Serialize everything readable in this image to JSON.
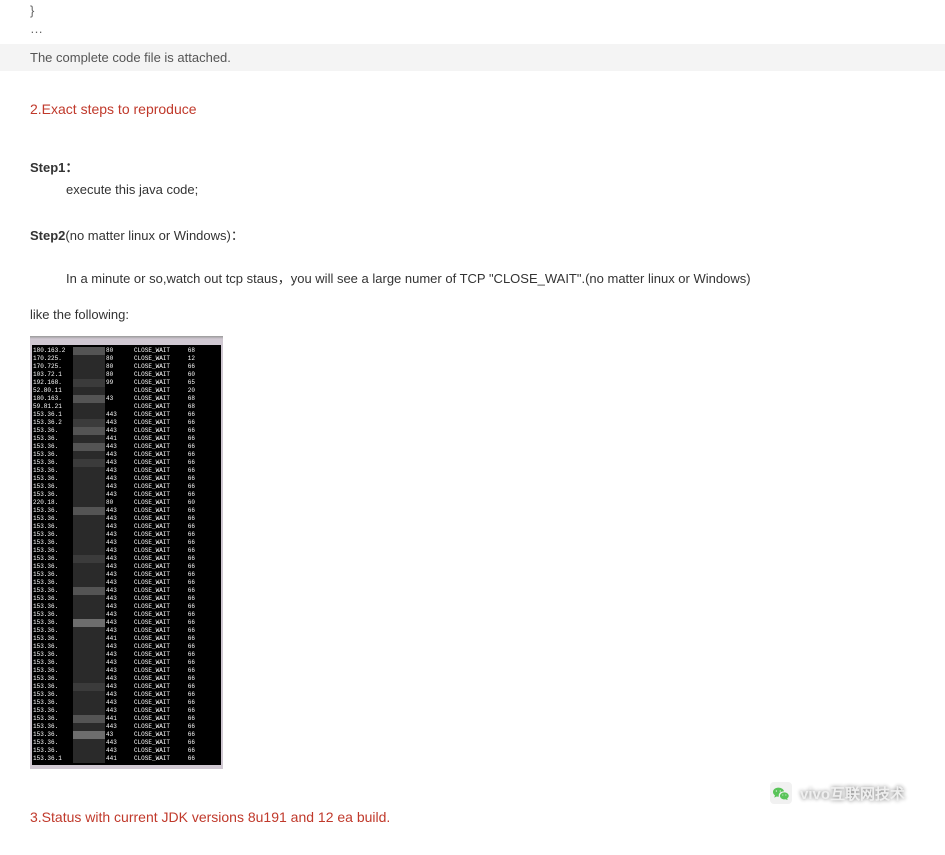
{
  "codeLines": [
    "}",
    "…"
  ],
  "attachedNote": "The complete code file is attached.",
  "section2": "2.Exact steps to reproduce",
  "step1Label": "Step1：",
  "step1Body": "execute this java code;",
  "step2Label": "Step2",
  "step2Rest": "(no matter linux or Windows)：",
  "watchLine": "In a minute or so,watch out tcp staus，you will see a large numer of TCP \"CLOSE_WAIT\".(no matter linux or Windows)",
  "likeLine": "like the following:",
  "section3": "3.Status with current JDK versions 8u191 and 12 ea build.",
  "watermarkText": "vivo互联网技术",
  "terminalRows": [
    {
      "ip": "180.163.2",
      "port": "80",
      "status": "CLOSE_WAIT",
      "count": "68",
      "mask": "c"
    },
    {
      "ip": "170.225.",
      "port": "80",
      "status": "CLOSE_WAIT",
      "count": "12",
      "mask": "a"
    },
    {
      "ip": "170.725.",
      "port": "80",
      "status": "CLOSE_WAIT",
      "count": "66",
      "mask": "a"
    },
    {
      "ip": "103.72.1",
      "port": "80",
      "status": "CLOSE_WAIT",
      "count": "60",
      "mask": "a"
    },
    {
      "ip": "192.168.",
      "port": "99",
      "status": "CLOSE_WAIT",
      "count": "65",
      "mask": "b"
    },
    {
      "ip": "52.80.11",
      "port": "",
      "status": "CLOSE_WAIT",
      "count": "20",
      "mask": "a"
    },
    {
      "ip": "180.163.",
      "port": "43",
      "status": "CLOSE_WAIT",
      "count": "68",
      "mask": "c"
    },
    {
      "ip": "59.81.21",
      "port": "",
      "status": "CLOSE_WAIT",
      "count": "68",
      "mask": "a"
    },
    {
      "ip": "153.36.1",
      "port": "443",
      "status": "CLOSE_WAIT",
      "count": "66",
      "mask": "a"
    },
    {
      "ip": "153.36.2",
      "port": "443",
      "status": "CLOSE_WAIT",
      "count": "66",
      "mask": "b"
    },
    {
      "ip": "153.36.",
      "port": "443",
      "status": "CLOSE_WAIT",
      "count": "66",
      "mask": "c"
    },
    {
      "ip": "153.36.",
      "port": "441",
      "status": "CLOSE_WAIT",
      "count": "66",
      "mask": "a"
    },
    {
      "ip": "153.36.",
      "port": "443",
      "status": "CLOSE_WAIT",
      "count": "66",
      "mask": "c"
    },
    {
      "ip": "153.36.",
      "port": "443",
      "status": "CLOSE_WAIT",
      "count": "66",
      "mask": "a"
    },
    {
      "ip": "153.36.",
      "port": "443",
      "status": "CLOSE_WAIT",
      "count": "66",
      "mask": "b"
    },
    {
      "ip": "153.36.",
      "port": "443",
      "status": "CLOSE_WAIT",
      "count": "66",
      "mask": "a"
    },
    {
      "ip": "153.36.",
      "port": "443",
      "status": "CLOSE_WAIT",
      "count": "66",
      "mask": "a"
    },
    {
      "ip": "153.36.",
      "port": "443",
      "status": "CLOSE_WAIT",
      "count": "66",
      "mask": "a"
    },
    {
      "ip": "153.36.",
      "port": "443",
      "status": "CLOSE_WAIT",
      "count": "66",
      "mask": "a"
    },
    {
      "ip": "220.18.",
      "port": "80",
      "status": "CLOSE_WAIT",
      "count": "60",
      "mask": "a"
    },
    {
      "ip": "153.36.",
      "port": "443",
      "status": "CLOSE_WAIT",
      "count": "66",
      "mask": "c"
    },
    {
      "ip": "153.36.",
      "port": "443",
      "status": "CLOSE_WAIT",
      "count": "66",
      "mask": "a"
    },
    {
      "ip": "153.36.",
      "port": "443",
      "status": "CLOSE_WAIT",
      "count": "66",
      "mask": "a"
    },
    {
      "ip": "153.36.",
      "port": "443",
      "status": "CLOSE_WAIT",
      "count": "66",
      "mask": "a"
    },
    {
      "ip": "153.36.",
      "port": "443",
      "status": "CLOSE_WAIT",
      "count": "66",
      "mask": "a"
    },
    {
      "ip": "153.36.",
      "port": "443",
      "status": "CLOSE_WAIT",
      "count": "66",
      "mask": "a"
    },
    {
      "ip": "153.36.",
      "port": "443",
      "status": "CLOSE_WAIT",
      "count": "66",
      "mask": "b"
    },
    {
      "ip": "153.36.",
      "port": "443",
      "status": "CLOSE_WAIT",
      "count": "66",
      "mask": "a"
    },
    {
      "ip": "153.36.",
      "port": "443",
      "status": "CLOSE_WAIT",
      "count": "66",
      "mask": "a"
    },
    {
      "ip": "153.36.",
      "port": "443",
      "status": "CLOSE_WAIT",
      "count": "66",
      "mask": "a"
    },
    {
      "ip": "153.36.",
      "port": "443",
      "status": "CLOSE_WAIT",
      "count": "66",
      "mask": "c"
    },
    {
      "ip": "153.36.",
      "port": "443",
      "status": "CLOSE_WAIT",
      "count": "66",
      "mask": "a"
    },
    {
      "ip": "153.36.",
      "port": "443",
      "status": "CLOSE_WAIT",
      "count": "66",
      "mask": "a"
    },
    {
      "ip": "153.36.",
      "port": "443",
      "status": "CLOSE_WAIT",
      "count": "66",
      "mask": "a"
    },
    {
      "ip": "153.36.",
      "port": "443",
      "status": "CLOSE_WAIT",
      "count": "66",
      "mask": "d"
    },
    {
      "ip": "153.36.",
      "port": "443",
      "status": "CLOSE_WAIT",
      "count": "66",
      "mask": "a"
    },
    {
      "ip": "153.36.",
      "port": "441",
      "status": "CLOSE_WAIT",
      "count": "66",
      "mask": "a"
    },
    {
      "ip": "153.36.",
      "port": "443",
      "status": "CLOSE_WAIT",
      "count": "66",
      "mask": "a"
    },
    {
      "ip": "153.36.",
      "port": "443",
      "status": "CLOSE_WAIT",
      "count": "66",
      "mask": "a"
    },
    {
      "ip": "153.36.",
      "port": "443",
      "status": "CLOSE_WAIT",
      "count": "66",
      "mask": "a"
    },
    {
      "ip": "153.36.",
      "port": "443",
      "status": "CLOSE_WAIT",
      "count": "66",
      "mask": "a"
    },
    {
      "ip": "153.36.",
      "port": "443",
      "status": "CLOSE_WAIT",
      "count": "66",
      "mask": "a"
    },
    {
      "ip": "153.36.",
      "port": "443",
      "status": "CLOSE_WAIT",
      "count": "66",
      "mask": "b"
    },
    {
      "ip": "153.36.",
      "port": "443",
      "status": "CLOSE_WAIT",
      "count": "66",
      "mask": "a"
    },
    {
      "ip": "153.36.",
      "port": "443",
      "status": "CLOSE_WAIT",
      "count": "66",
      "mask": "a"
    },
    {
      "ip": "153.36.",
      "port": "443",
      "status": "CLOSE_WAIT",
      "count": "66",
      "mask": "a"
    },
    {
      "ip": "153.36.",
      "port": "441",
      "status": "CLOSE_WAIT",
      "count": "66",
      "mask": "c"
    },
    {
      "ip": "153.36.",
      "port": "443",
      "status": "CLOSE_WAIT",
      "count": "66",
      "mask": "a"
    },
    {
      "ip": "153.36.",
      "port": "43",
      "status": "CLOSE_WAIT",
      "count": "66",
      "mask": "d"
    },
    {
      "ip": "153.36.",
      "port": "443",
      "status": "CLOSE_WAIT",
      "count": "66",
      "mask": "a"
    },
    {
      "ip": "153.36.",
      "port": "443",
      "status": "CLOSE_WAIT",
      "count": "66",
      "mask": "a"
    },
    {
      "ip": "153.36.1",
      "port": "441",
      "status": "CLOSE_WAIT",
      "count": "66",
      "mask": "a"
    }
  ]
}
